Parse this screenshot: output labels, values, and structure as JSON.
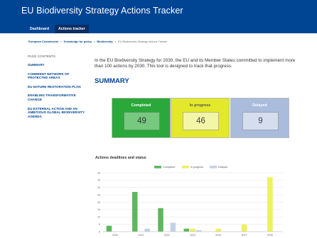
{
  "header": {
    "title": "EU Biodiversity Strategy Actions Tracker",
    "tabs": [
      {
        "label": "Dashboard",
        "active": false
      },
      {
        "label": "Actions tracker",
        "active": true
      }
    ]
  },
  "breadcrumb": [
    "European Commission",
    "Knowledge for policy",
    "Biodiversity",
    "EU Biodiversity Strategy Actions Tracker"
  ],
  "sidebar": {
    "heading": "PAGE CONTENTS",
    "items": [
      "SUMMARY",
      "COHERENT NETWORK OF PROTECTED AREAS",
      "EU NATURE RESTORATION PLAN",
      "ENABLING TRANSFORMATIVE CHANGE",
      "EU EXTERNAL ACTION AND AN AMBITIOUS GLOBAL BIODIVERSITY AGENDA"
    ]
  },
  "main": {
    "intro": "In the EU Biodiversity Strategy for 2030, the EU and its Member States committed to implement more than 100 actions by 2030. This tool is designed to track that progress.",
    "summary_title": "SUMMARY",
    "cards": {
      "completed": {
        "label": "Completed",
        "value": "49"
      },
      "in_progress": {
        "label": "In progress",
        "value": "46"
      },
      "delayed": {
        "label": "Delayed",
        "value": "9"
      }
    },
    "chart_title": "Actions deadlines and status"
  },
  "colors": {
    "header": "#004494",
    "completed": "#5cb85c",
    "in_progress": "#eef062",
    "delayed": "#c3d1e8"
  },
  "chart_data": {
    "type": "bar",
    "categories": [
      "2020",
      "2021",
      "2022",
      "2023",
      "2024",
      "2027",
      "2030"
    ],
    "series": [
      {
        "name": "Completed",
        "values": [
          4,
          27,
          16,
          2,
          0,
          0,
          0
        ]
      },
      {
        "name": "In progress",
        "values": [
          0,
          0,
          0,
          2,
          2,
          5,
          37
        ]
      },
      {
        "name": "Delayed",
        "values": [
          0,
          2,
          6,
          1,
          0,
          0,
          0
        ]
      }
    ],
    "ylim": [
      0,
      40
    ],
    "yticks": [
      0,
      5,
      10,
      15,
      20,
      25,
      30,
      35,
      40
    ],
    "grid": true,
    "legend": "top-center"
  }
}
